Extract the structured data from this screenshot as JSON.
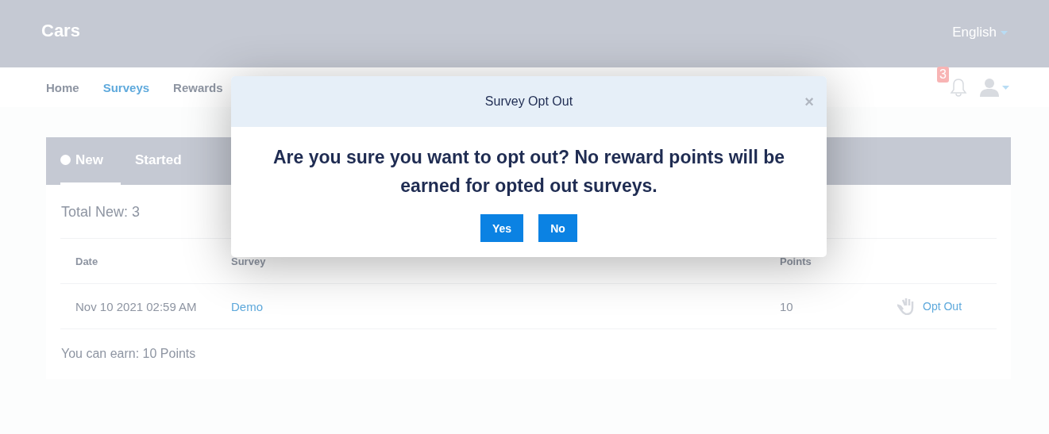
{
  "header": {
    "title": "Cars",
    "language": "English"
  },
  "nav": {
    "items": [
      {
        "label": "Home",
        "selected": false
      },
      {
        "label": "Surveys",
        "selected": true
      },
      {
        "label": "Rewards",
        "selected": false
      }
    ],
    "notification_count": "3"
  },
  "tabs": [
    {
      "label": "New",
      "selected": true
    },
    {
      "label": "Started",
      "selected": false
    }
  ],
  "total": "Total New: 3",
  "table": {
    "columns": [
      "Date",
      "Survey",
      "Points"
    ],
    "rows": [
      {
        "date": "Nov 10 2021 02:59 AM",
        "survey": "Demo",
        "points": "10",
        "action": "Opt Out"
      }
    ]
  },
  "footer": "You can earn: 10 Points",
  "modal": {
    "title": "Survey Opt Out",
    "close": "×",
    "message": "Are you sure you want to opt out? No reward points will be earned for opted out surveys.",
    "buttons": [
      "Yes",
      "No"
    ]
  }
}
